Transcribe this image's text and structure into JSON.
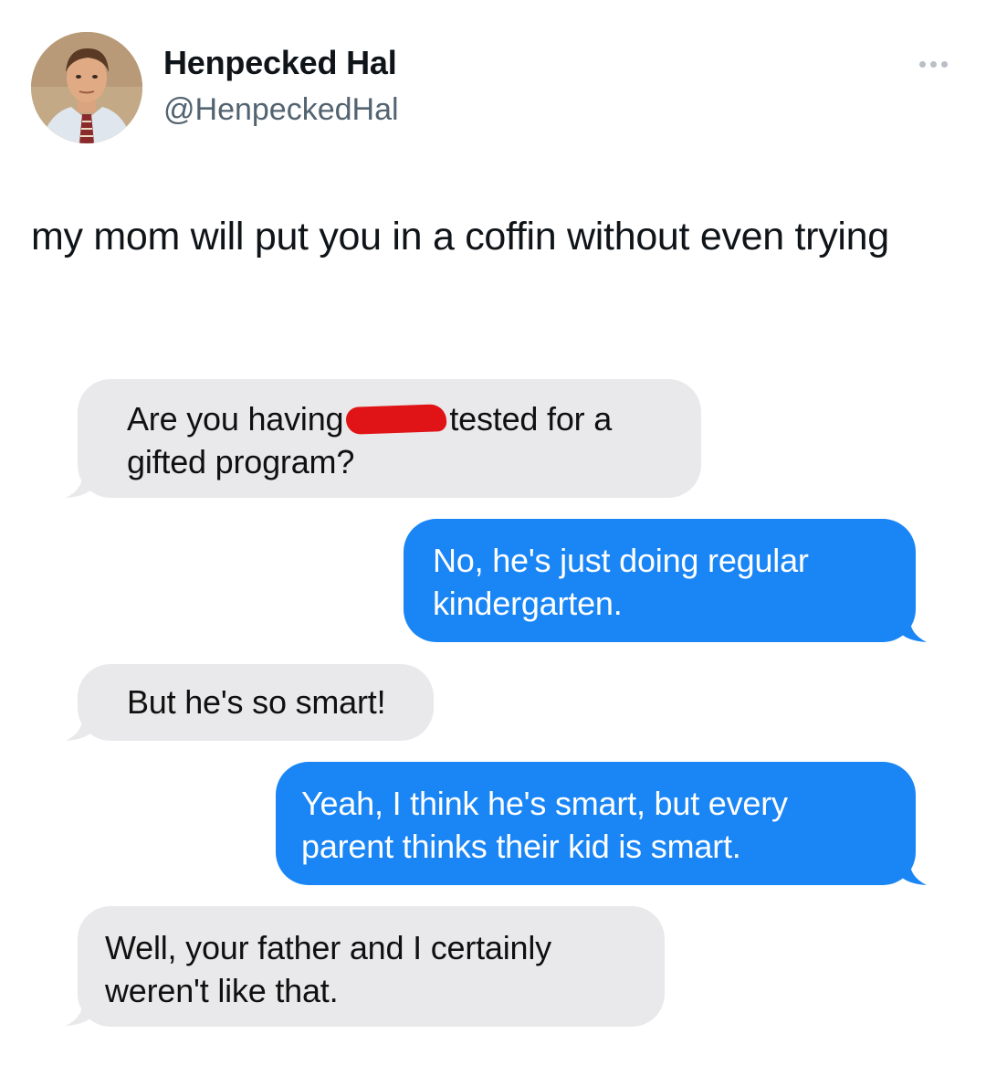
{
  "author": {
    "display_name": "Henpecked Hal",
    "handle": "@HenpeckedHal",
    "avatar_icon": "profile-photo",
    "more_icon": "more-dots-icon"
  },
  "tweet": {
    "text": "my mom will put you in a coffin without even trying"
  },
  "messages": [
    {
      "direction": "incoming",
      "before_redaction": "Are you having",
      "after_redaction": "tested for a",
      "line2": "gifted program?"
    },
    {
      "direction": "outgoing",
      "line1": "No, he's just doing regular",
      "line2": "kindergarten."
    },
    {
      "direction": "incoming",
      "line1": "But he's so smart!"
    },
    {
      "direction": "outgoing",
      "line1": "Yeah, I think he's smart, but every",
      "line2": "parent thinks their kid is smart."
    },
    {
      "direction": "incoming",
      "line1": "Well, your father and I certainly",
      "line2": "weren't like that."
    }
  ],
  "colors": {
    "incoming_bubble": "#e9e9eb",
    "outgoing_bubble": "#1a86f5",
    "redaction": "#e01416",
    "handle_gray": "#536471"
  }
}
